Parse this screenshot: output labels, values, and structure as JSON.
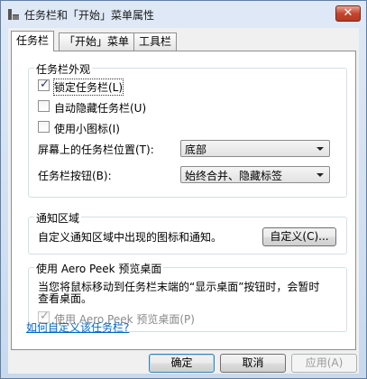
{
  "window": {
    "title": "任务栏和「开始」菜单属性",
    "close_glyph": "✕"
  },
  "tabs": [
    {
      "label": "任务栏"
    },
    {
      "label": "「开始」菜单"
    },
    {
      "label": "工具栏"
    }
  ],
  "appearance": {
    "legend": "任务栏外观",
    "lock_label": "锁定任务栏(L)",
    "lock_checked": true,
    "autohide_label": "自动隐藏任务栏(U)",
    "autohide_checked": false,
    "small_icons_label": "使用小图标(I)",
    "small_icons_checked": false,
    "location_label": "屏幕上的任务栏位置(T):",
    "location_value": "底部",
    "buttons_label": "任务栏按钮(B):",
    "buttons_value": "始终合并、隐藏标签"
  },
  "notification": {
    "legend": "通知区域",
    "description": "自定义通知区域中出现的图标和通知。",
    "customize_button": "自定义(C)..."
  },
  "aero_peek": {
    "legend": "使用 Aero Peek 预览桌面",
    "description_line1": "当您将鼠标移动到任务栏末端的“显示桌面”按钮时，会暂时",
    "description_line2": "查看桌面。",
    "checkbox_label": "使用 Aero Peek 预览桌面(P)",
    "checkbox_checked": true
  },
  "help_link": "如何自定义该任务栏?",
  "footer": {
    "ok": "确定",
    "cancel": "取消",
    "apply": "应用(A)"
  }
}
